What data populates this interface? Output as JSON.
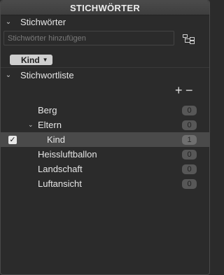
{
  "panel": {
    "title": "STICHWÖRTER"
  },
  "keywords_section": {
    "header": "Stichwörter",
    "input_placeholder": "Stichwörter hinzufügen",
    "tag": "Kind"
  },
  "list_section": {
    "header": "Stichwortliste",
    "add": "+",
    "remove": "−",
    "items": [
      {
        "label": "Berg",
        "count": "0",
        "checked": false
      },
      {
        "label": "Eltern",
        "count": "0",
        "checked": false,
        "expanded": true
      },
      {
        "label": "Kind",
        "count": "1",
        "checked": true,
        "selected": true
      },
      {
        "label": "Heissluftballon",
        "count": "0",
        "checked": false
      },
      {
        "label": "Landschaft",
        "count": "0",
        "checked": false
      },
      {
        "label": "Luftansicht",
        "count": "0",
        "checked": false
      }
    ]
  },
  "icons": {
    "section_collapse": "chevron-down-icon",
    "tree_view": "hierarchy-icon",
    "tag_menu": "caret-down-icon",
    "expanded": "disclosure-down-icon",
    "check": "check-icon"
  }
}
